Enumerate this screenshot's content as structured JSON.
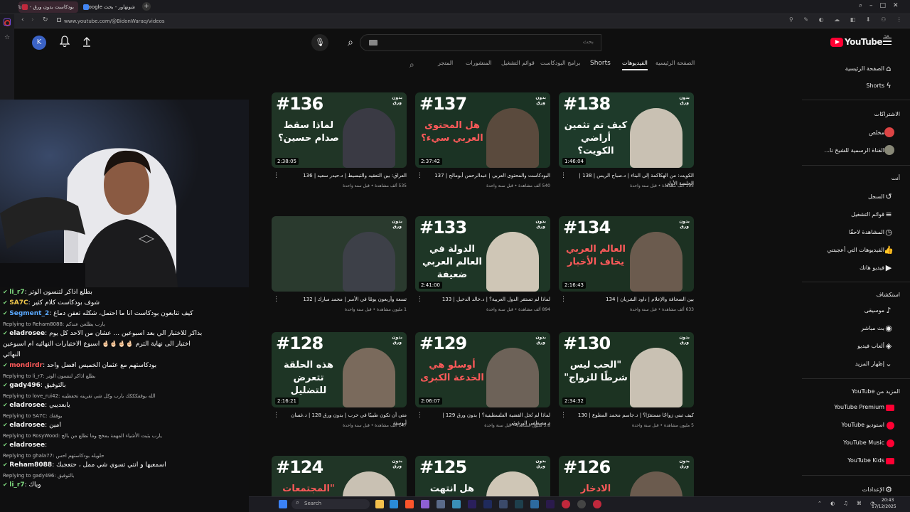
{
  "browser": {
    "tabs": [
      {
        "title": "بودكاست بدون ورق - Tube",
        "active": true,
        "color": "#c0283c"
      },
      {
        "title": "شونهاور - بحث Google",
        "active": false,
        "color": "#4285f4"
      }
    ],
    "url": "www.youtube.com/@BidonWaraq/videos"
  },
  "header": {
    "avatar_letter": "K",
    "search_placeholder": "بحث",
    "logo_text": "YouTube",
    "logo_region": "SA"
  },
  "channel_tabs": [
    "الصفحة الرئيسية",
    "الفيديوهات",
    "Shorts",
    "برامج البودكاست",
    "قوائم التشغيل",
    "المنشورات",
    "المتجر"
  ],
  "sidebar": {
    "top": [
      {
        "label": "الصفحة الرئيسية",
        "icon": "home-icon",
        "glyph": "⌂"
      },
      {
        "label": "Shorts",
        "icon": "shorts-icon",
        "glyph": "ϟ"
      }
    ],
    "subs_header": "الاشتراكات",
    "subs": [
      {
        "label": "مخلص",
        "color": "#d44"
      },
      {
        "label": "القناة الرسمية للشيخ نا...",
        "color": "#887"
      }
    ],
    "you_header": "أنت",
    "you": [
      {
        "label": "السجل",
        "icon": "history-icon",
        "glyph": "↺"
      },
      {
        "label": "قوائم التشغيل",
        "icon": "playlists-icon",
        "glyph": "≡"
      },
      {
        "label": "المشاهدة لاحقًا",
        "icon": "watch-later-icon",
        "glyph": "◷"
      },
      {
        "label": "الفيديوهات التي أعجبتني",
        "icon": "like-icon",
        "glyph": "👍"
      },
      {
        "label": "فيديو هاتك",
        "icon": "your-videos-icon",
        "glyph": "▶"
      }
    ],
    "explore_header": "استكشاف",
    "explore": [
      {
        "label": "موسيقى",
        "icon": "music-icon",
        "glyph": "♪"
      },
      {
        "label": "بث مباشر",
        "icon": "live-icon",
        "glyph": "◉"
      },
      {
        "label": "ألعاب فيديو",
        "icon": "gaming-icon",
        "glyph": "◈"
      },
      {
        "label": "إظهار المزيد",
        "icon": "chevron-down-icon",
        "glyph": "⌄"
      }
    ],
    "more_header": "المزيد من YouTube",
    "more": [
      {
        "label": "YouTube Premium"
      },
      {
        "label": "استوديو YouTube"
      },
      {
        "label": "YouTube Music"
      },
      {
        "label": "YouTube Kids"
      }
    ],
    "settings": "الإعدادات"
  },
  "videos": [
    {
      "num": "#138",
      "overlay": "كيف تم تثمين أراضي الكويت؟",
      "tag": "الجلسة الأولى",
      "duration": "1:46:04",
      "title": "الكويت: من الهكاكمة إلى البناء | د.صباح الريس | 138 | الجلسة الأولى",
      "meta": "195 ألف مشاهدة • قبل سنة واحدة",
      "bg": "#1e3a2a",
      "person": "#c9c1b3"
    },
    {
      "num": "#137",
      "overlay": "هل المحتوى العربي سيء؟",
      "duration": "2:37:42",
      "title": "البودكاست والمحتوى العربي | عبدالرحمن أبومالح | 137",
      "meta": "540 ألف مشاهدة • قبل سنة واحدة",
      "bg": "#1b3324",
      "person": "#5a4a3d"
    },
    {
      "num": "#136",
      "overlay": "لماذا سقط صدام حسين؟",
      "duration": "2:38:05",
      "title": "العراق: بين التعقيد والتبسيط | د.حيدر سعيد | 136",
      "meta": "535 ألف مشاهدة • قبل سنة واحدة",
      "bg": "#203526",
      "person": "#3a3a44"
    },
    {
      "num": "#134",
      "overlay": "العالم العربي يخاف الأخبار",
      "duration": "2:16:43",
      "title": "بين الصحافة والإعلام | داود الشريان | 134",
      "meta": "633 ألف مشاهدة • قبل سنة واحدة",
      "bg": "#1c3122",
      "person": "#6b5b4e"
    },
    {
      "num": "#133",
      "overlay": "الدولة في العالم العربي ضعيفة",
      "duration": "2:41:00",
      "title": "لماذا لم تستقر الدول العربية؟ | د.خالد الدخيل | 133",
      "meta": "894 ألف مشاهدة • قبل سنة واحدة",
      "bg": "#1e3626",
      "person": "#cfc6b6"
    },
    {
      "num": "",
      "overlay": "",
      "duration": "",
      "title": "تسعة وأربعون يومًا في الأسر | محمد مبارك | 132",
      "meta": "1 مليون مشاهدة • قبل سنة واحدة",
      "bg": "#2a3a2e",
      "person": "#3d4048"
    },
    {
      "num": "#130",
      "overlay": "\"الحب ليس شرطًا للزواج\"",
      "duration": "2:34:32",
      "title": "كيف تبني زواجًا مستقرًا؟ | د.جاسم محمد المطوع | 130",
      "meta": "5 مليون مشاهدة • قبل سنة واحدة",
      "bg": "#1c3322",
      "person": "#c9c1b3"
    },
    {
      "num": "#129",
      "overlay": "أوسلو هي الخدعة الكبرى",
      "duration": "2:06:07",
      "title": "لماذا لم تُحل القضية الفلسطينية؟ | بدون ورق 129 | د.مصطفى البرغوثي",
      "meta": "3.8 مليون مشاهدة • قبل سنة واحدة",
      "bg": "#1d3424",
      "person": "#6d6258"
    },
    {
      "num": "#128",
      "overlay": "هذه الحلقة تتعرض للتضليل",
      "duration": "2:16:21",
      "title": "متى أن تكون طبيبًا في حرب | بدون ورق 128 | د.غسان أبوستة",
      "meta": "147 ألف مشاهدة • قبل سنة واحدة",
      "bg": "#1e3525",
      "person": "#7a6a5c"
    },
    {
      "num": "#126",
      "overlay": "الادخار",
      "duration": "",
      "title": "",
      "meta": "",
      "bg": "#1c3122",
      "person": "#6b5b4e"
    },
    {
      "num": "#125",
      "overlay": "هل انتهت",
      "duration": "",
      "title": "",
      "meta": "",
      "bg": "#1e3626",
      "person": "#cfc6b6"
    },
    {
      "num": "#124",
      "overlay": "\"المجتمعات",
      "duration": "",
      "title": "",
      "meta": "",
      "bg": "#203526",
      "person": "#c9c1b3"
    }
  ],
  "chat": [
    {
      "reply": "",
      "user": "li_r7",
      "ucolor": "#7fd97f",
      "text": "بطلع اذاكر لتنسون الوتر"
    },
    {
      "reply": "",
      "user": "SA7C",
      "ucolor": "#f2c94c",
      "text": "شوف بودكاست كلام كثير"
    },
    {
      "reply": "",
      "user": "Segment_2",
      "ucolor": "#5aa9ff",
      "text": "كيف تتابعون بودكاست انا ما احتمل، شكله تعفن دماغ"
    },
    {
      "reply": "Replying to Reham8088: يارب يطلعن عندكم",
      "user": "",
      "ucolor": "",
      "text": ""
    },
    {
      "reply": "",
      "user": "eladrosee",
      "ucolor": "#f2f2f2",
      "text": "بذاكر للاختبار الي بعد اسبوعين ... عشان من الاحد كل يوم"
    },
    {
      "reply": "",
      "user": "",
      "ucolor": "",
      "text": "اختبار الى نهاية الترم 🤞🏻🤞🏻🤞🏻🤞🏻 اسبوع الاختبارات النهائيه ام اسبوعين"
    },
    {
      "reply": "",
      "user": "",
      "ucolor": "",
      "text": "النهائي"
    },
    {
      "reply": "",
      "user": "mondirdr",
      "ucolor": "#ff5a5a",
      "text": "بودكاستهم مع عثمان الخميس أفضل واحد"
    },
    {
      "reply": "Replying to li_r7: بطلع اذاكر لتنسون الوتر",
      "user": "",
      "ucolor": "",
      "text": ""
    },
    {
      "reply": "",
      "user": "gady496",
      "ucolor": "#f2f2f2",
      "text": "بالتوفيق"
    },
    {
      "reply": "Replying to love_rui42: الله يوفقكككك يارب وكل شي تقرينه تحفظينه",
      "user": "",
      "ucolor": "",
      "text": ""
    },
    {
      "reply": "",
      "user": "eladrosee",
      "ucolor": "#f2f2f2",
      "text": "يابعديبي"
    },
    {
      "reply": "Replying to SA7C: يوفقك",
      "user": "",
      "ucolor": "",
      "text": ""
    },
    {
      "reply": "",
      "user": "eladrosee",
      "ucolor": "#f2f2f2",
      "text": "امين"
    },
    {
      "reply": "Replying to RosyWood: يارب يثبت الأشياء المهمة بمخج وما تطلع من بالج",
      "user": "",
      "ucolor": "",
      "text": ""
    },
    {
      "reply": "",
      "user": "eladrosee",
      "ucolor": "#f2f2f2",
      "text": ""
    },
    {
      "reply": "Replying to ghala77: حلويله بودكاستهم احس",
      "user": "",
      "ucolor": "",
      "text": ""
    },
    {
      "reply": "",
      "user": "Reham8088",
      "ucolor": "#f2f2f2",
      "text": "اسمعيها و أنتي تسوي شي ممل ، حتعجبك"
    },
    {
      "reply": "Replying to gady496: بالتوفيق",
      "user": "",
      "ucolor": "",
      "text": ""
    },
    {
      "reply": "",
      "user": "li_r7",
      "ucolor": "#7fd97f",
      "text": "وياك"
    }
  ],
  "taskbar": {
    "search_label": "Search",
    "time": "20:43",
    "date": "17/12/2025"
  },
  "colors": {
    "yt_red": "#ff0033",
    "accent": "#3ea6ff"
  }
}
